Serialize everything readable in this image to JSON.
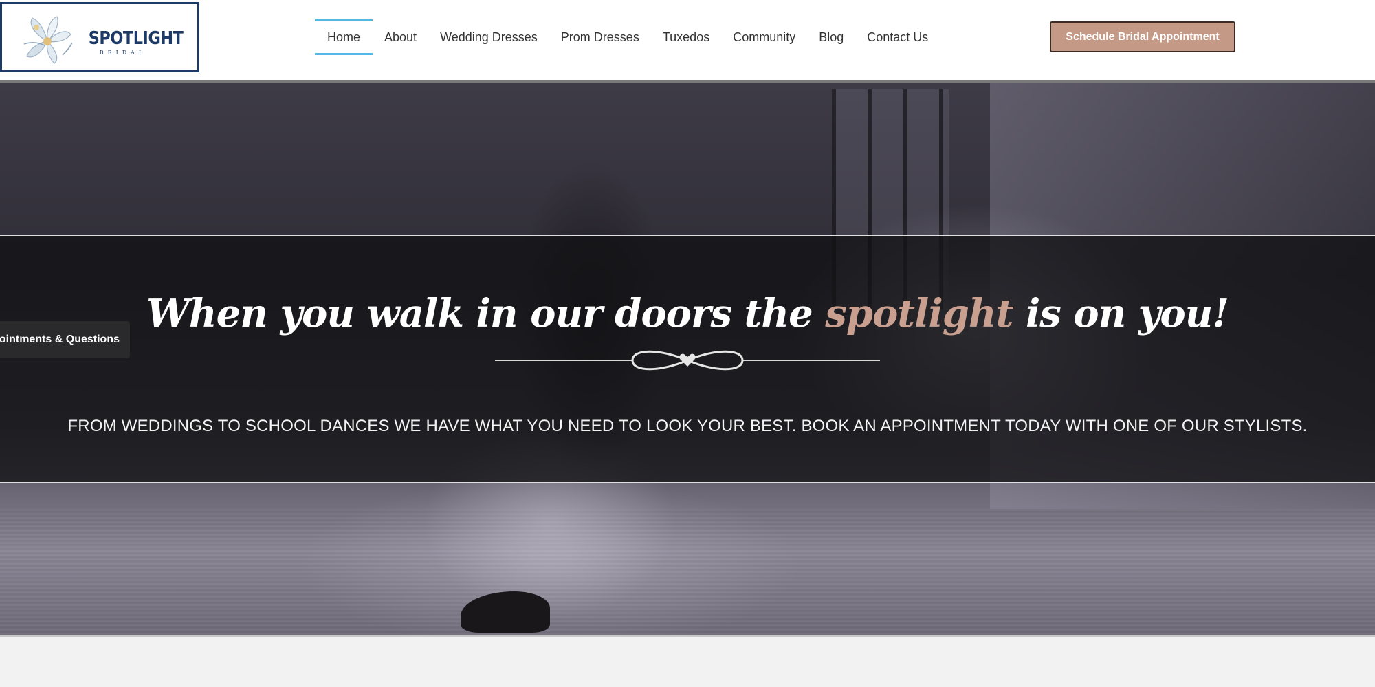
{
  "logo": {
    "name": "SPOTLIGHT",
    "sub": "BRIDAL"
  },
  "nav": {
    "items": [
      {
        "label": "Home",
        "active": true
      },
      {
        "label": "About"
      },
      {
        "label": "Wedding Dresses"
      },
      {
        "label": "Prom Dresses"
      },
      {
        "label": "Tuxedos"
      },
      {
        "label": "Community"
      },
      {
        "label": "Blog"
      },
      {
        "label": "Contact Us"
      }
    ]
  },
  "cta": {
    "label": "Schedule Bridal Appointment",
    "color": "#c49986"
  },
  "hero": {
    "title_before": "When you walk in our doors the ",
    "title_accent": "spotlight",
    "title_after": " is on you!",
    "subtitle": "FROM WEDDINGS TO SCHOOL DANCES WE HAVE WHAT YOU NEED TO LOOK YOUR BEST. BOOK AN APPOINTMENT TODAY WITH ONE OF OUR STYLISTS.",
    "accent_color": "#c9a08f"
  },
  "side_tab": {
    "label": "Appointments & Questions"
  },
  "colors": {
    "nav_active": "#54b8e5",
    "brand_navy": "#1e3a66"
  }
}
